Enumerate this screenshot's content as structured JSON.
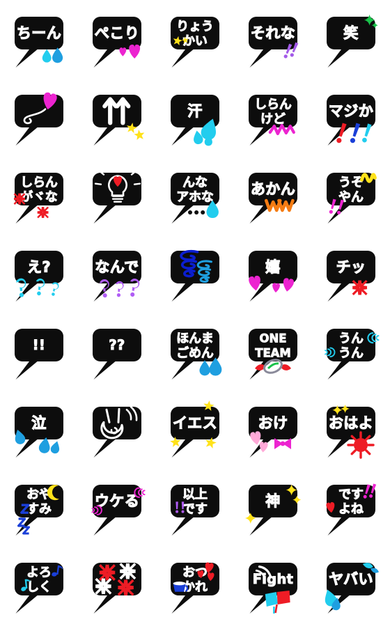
{
  "page": {
    "kind": "emoji-sticker-sheet",
    "title": "Japanese speech-bubble emoji set",
    "background_color": "#ffffff",
    "columns": 5,
    "rows": 8,
    "cell_size_px": 112,
    "bubble_color": "#0d0d0d",
    "text_color": "#ffffff"
  },
  "palette": {
    "black": "#0d0d0d",
    "white": "#ffffff",
    "cyan": "#22cdee",
    "sky": "#1f9fe0",
    "blue": "#1a3fd8",
    "navy": "#0b1ecf",
    "magenta": "#ec24d0",
    "pink": "#ff5fc8",
    "lightpink": "#ffaad8",
    "purple": "#a35ae8",
    "violet": "#b05cf5",
    "red": "#ee1c25",
    "crimson": "#e8242c",
    "orange": "#f57c13",
    "yellow": "#ffe21a",
    "gold": "#ffd400",
    "green": "#19c24a"
  },
  "stickers": [
    {
      "id": 1,
      "row": 1,
      "col": 1,
      "label": "ちーん",
      "lines": [
        "ちーん"
      ],
      "decor": "two-blue-teardrops",
      "decor_colors": [
        "#22cdee",
        "#1f9fe0"
      ]
    },
    {
      "id": 2,
      "row": 1,
      "col": 2,
      "label": "ぺこり",
      "lines": [
        "ぺこり"
      ],
      "decor": "two-magenta-hearts",
      "decor_colors": [
        "#ec24d0",
        "#ec24d0"
      ]
    },
    {
      "id": 3,
      "row": 1,
      "col": 3,
      "label": "りょうかい",
      "lines": [
        "りょう",
        "かい"
      ],
      "decor": "yellow-stars",
      "decor_colors": [
        "#ffe21a"
      ]
    },
    {
      "id": 4,
      "row": 1,
      "col": 4,
      "label": "それな",
      "lines": [
        "それな"
      ],
      "decor": "purple-double-exclaim",
      "decor_colors": [
        "#a35ae8"
      ]
    },
    {
      "id": 5,
      "row": 1,
      "col": 5,
      "label": "笑",
      "lines": [
        "笑"
      ],
      "decor": "green-sparkle",
      "decor_colors": [
        "#19c24a"
      ]
    },
    {
      "id": 6,
      "row": 2,
      "col": 1,
      "label": "heart-balloon",
      "lines": [],
      "decor": "magenta-heart-balloon",
      "decor_colors": [
        "#ec24d0",
        "#ffffff"
      ]
    },
    {
      "id": 7,
      "row": 2,
      "col": 2,
      "label": "up-arrows",
      "lines": [],
      "decor": "two-white-up-arrows-stars",
      "decor_colors": [
        "#ffffff",
        "#ffe21a"
      ]
    },
    {
      "id": 8,
      "row": 2,
      "col": 3,
      "label": "汗",
      "lines": [
        "汗"
      ],
      "decor": "cyan-sweat-drops",
      "decor_colors": [
        "#22cdee"
      ]
    },
    {
      "id": 9,
      "row": 2,
      "col": 4,
      "label": "しらんけど",
      "lines": [
        "しらん",
        "けど"
      ],
      "decor": "magenta-zigzag",
      "decor_colors": [
        "#ec24d0"
      ]
    },
    {
      "id": 10,
      "row": 2,
      "col": 5,
      "label": "マジか",
      "lines": [
        "マジか"
      ],
      "decor": "rgb-exclaims",
      "decor_colors": [
        "#ee1c25",
        "#1a3fd8",
        "#22cdee"
      ]
    },
    {
      "id": 11,
      "row": 3,
      "col": 1,
      "label": "しらんがな",
      "lines": [
        "しらん",
        "がヾな"
      ],
      "decor": "red-anger-marks",
      "decor_colors": [
        "#ee1c25"
      ]
    },
    {
      "id": 12,
      "row": 3,
      "col": 2,
      "label": "lightbulb",
      "lines": [],
      "decor": "lightbulb-with-red-heart",
      "decor_colors": [
        "#ffffff",
        "#ee1c25"
      ]
    },
    {
      "id": 13,
      "row": 3,
      "col": 3,
      "label": "んなアホな",
      "lines": [
        "んな",
        "アホな"
      ],
      "decor": "dots-and-cyan-drop",
      "decor_colors": [
        "#0d0d0d",
        "#22cdee"
      ]
    },
    {
      "id": 14,
      "row": 3,
      "col": 4,
      "label": "あかんww",
      "lines": [
        "あかん"
      ],
      "decor": "orange-ww",
      "decor_colors": [
        "#f57c13"
      ]
    },
    {
      "id": 15,
      "row": 3,
      "col": 5,
      "label": "うそやん",
      "lines": [
        "うそ",
        "やん"
      ],
      "decor": "yellow-squiggle-magenta-exclaim",
      "decor_colors": [
        "#ffe21a",
        "#ec24d0"
      ]
    },
    {
      "id": 16,
      "row": 4,
      "col": 1,
      "label": "え?",
      "lines": [
        "え?"
      ],
      "decor": "cyan-question-marks",
      "decor_colors": [
        "#22cdee"
      ]
    },
    {
      "id": 17,
      "row": 4,
      "col": 2,
      "label": "なんで",
      "lines": [
        "なんで"
      ],
      "decor": "purple-question-marks",
      "decor_colors": [
        "#b05cf5"
      ]
    },
    {
      "id": 18,
      "row": 4,
      "col": 3,
      "label": "guruguru",
      "lines": [],
      "decor": "blue-swirls",
      "decor_colors": [
        "#0b1ecf",
        "#1f9fe0"
      ]
    },
    {
      "id": 19,
      "row": 4,
      "col": 4,
      "label": "嬉",
      "lines": [
        "嬉"
      ],
      "decor": "magenta-hearts",
      "decor_colors": [
        "#ec24d0"
      ]
    },
    {
      "id": 20,
      "row": 4,
      "col": 5,
      "label": "チッ",
      "lines": [
        "チッ"
      ],
      "decor": "red-anger-mark",
      "decor_colors": [
        "#ee1c25"
      ]
    },
    {
      "id": 21,
      "row": 5,
      "col": 1,
      "label": "!!",
      "lines": [
        "!!"
      ],
      "decor": "none",
      "decor_colors": []
    },
    {
      "id": 22,
      "row": 5,
      "col": 2,
      "label": "??",
      "lines": [
        "??"
      ],
      "decor": "none",
      "decor_colors": []
    },
    {
      "id": 23,
      "row": 5,
      "col": 3,
      "label": "ほんまごめん",
      "lines": [
        "ほんま",
        "ごめん"
      ],
      "decor": "blue-teardrops",
      "decor_colors": [
        "#1f9fe0"
      ]
    },
    {
      "id": 24,
      "row": 5,
      "col": 4,
      "label": "ONE TEAM",
      "lines": [
        "ONE",
        "TEAM"
      ],
      "decor": "rugby-ball",
      "decor_colors": [
        "#ee1c25",
        "#8a8a9a",
        "#19c24a"
      ]
    },
    {
      "id": 25,
      "row": 5,
      "col": 5,
      "label": "うんうん",
      "lines": [
        "うん",
        "うん"
      ],
      "decor": "cyan-motion-arcs",
      "decor_colors": [
        "#22cdee"
      ]
    },
    {
      "id": 26,
      "row": 6,
      "col": 1,
      "label": "泣",
      "lines": [
        "泣"
      ],
      "decor": "blue-tears",
      "decor_colors": [
        "#1f9fe0"
      ]
    },
    {
      "id": 27,
      "row": 6,
      "col": 2,
      "label": "peace-hand",
      "lines": [],
      "decor": "white-peace-hand",
      "decor_colors": [
        "#ffffff"
      ]
    },
    {
      "id": 28,
      "row": 6,
      "col": 3,
      "label": "イエス",
      "lines": [
        "イエス"
      ],
      "decor": "yellow-stars",
      "decor_colors": [
        "#ffe21a"
      ]
    },
    {
      "id": 29,
      "row": 6,
      "col": 4,
      "label": "おけ",
      "lines": [
        "おけ"
      ],
      "decor": "pink-hearts-magenta-ribbon",
      "decor_colors": [
        "#ffaad8",
        "#ec24d0"
      ]
    },
    {
      "id": 30,
      "row": 6,
      "col": 5,
      "label": "おはよ",
      "lines": [
        "おはよ"
      ],
      "decor": "yellow-sparkle-red-sun",
      "decor_colors": [
        "#ffe21a",
        "#ee1c25"
      ]
    },
    {
      "id": 31,
      "row": 7,
      "col": 1,
      "label": "おやすみ",
      "lines": [
        "おや",
        "すみ"
      ],
      "decor": "yellow-moon-blue-zzz",
      "decor_colors": [
        "#ffe21a",
        "#1a3fd8"
      ]
    },
    {
      "id": 32,
      "row": 7,
      "col": 2,
      "label": "ウケる",
      "lines": [
        "ウケる"
      ],
      "decor": "magenta-motion-arcs",
      "decor_colors": [
        "#ec24d0"
      ]
    },
    {
      "id": 33,
      "row": 7,
      "col": 3,
      "label": "以上です",
      "lines": [
        "以上",
        "です"
      ],
      "decor": "purple-double-exclaim",
      "decor_colors": [
        "#b05cf5"
      ]
    },
    {
      "id": 34,
      "row": 7,
      "col": 4,
      "label": "神",
      "lines": [
        "神"
      ],
      "decor": "yellow-sparkles",
      "decor_colors": [
        "#ffe21a"
      ]
    },
    {
      "id": 35,
      "row": 7,
      "col": 5,
      "label": "ですよね",
      "lines": [
        "です",
        "よね"
      ],
      "decor": "magenta-exclaim-red-heart",
      "decor_colors": [
        "#ec24d0",
        "#ee1c25"
      ]
    },
    {
      "id": 36,
      "row": 8,
      "col": 1,
      "label": "よろしく",
      "lines": [
        "よろ",
        "しく"
      ],
      "decor": "music-notes",
      "decor_colors": [
        "#1a3fd8",
        "#22cdee"
      ]
    },
    {
      "id": 37,
      "row": 8,
      "col": 2,
      "label": "anger-marks",
      "lines": [],
      "decor": "red-white-anger-marks",
      "decor_colors": [
        "#ee1c25",
        "#ffffff"
      ]
    },
    {
      "id": 38,
      "row": 8,
      "col": 3,
      "label": "おつかれ",
      "lines": [
        "おつ",
        "かれ"
      ],
      "decor": "red-hearts-blue-cup",
      "decor_colors": [
        "#ee1c25",
        "#1a3fd8"
      ]
    },
    {
      "id": 39,
      "row": 8,
      "col": 4,
      "label": "Fight",
      "lines": [
        "Fight"
      ],
      "decor": "cyan-red-flags",
      "decor_colors": [
        "#22cdee",
        "#ee1c25"
      ]
    },
    {
      "id": 40,
      "row": 8,
      "col": 5,
      "label": "ヤバい",
      "lines": [
        "ヤバい"
      ],
      "decor": "cyan-splashes",
      "decor_colors": [
        "#22cdee",
        "#1f9fe0"
      ]
    }
  ]
}
